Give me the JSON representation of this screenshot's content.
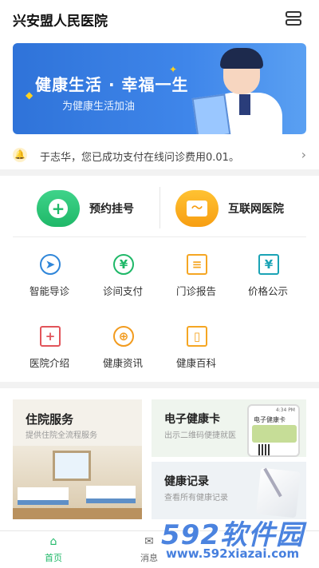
{
  "header": {
    "title": "兴安盟人民医院",
    "menu_icon": "menu-icon"
  },
  "banner": {
    "title": "健康生活 · 幸福一生",
    "subtitle": "为健康生活加油"
  },
  "notice": {
    "text": "于志华，您已成功支付在线问诊费用0.01。"
  },
  "primary_services": [
    {
      "label": "预约挂号",
      "icon": "hospital-cross-icon"
    },
    {
      "label": "互联网医院",
      "icon": "monitor-icon"
    }
  ],
  "grid": [
    {
      "label": "智能导诊",
      "icon": "navigation-icon"
    },
    {
      "label": "诊间支付",
      "icon": "yuan-icon"
    },
    {
      "label": "门诊报告",
      "icon": "report-icon"
    },
    {
      "label": "价格公示",
      "icon": "price-board-icon"
    },
    {
      "label": "医院介绍",
      "icon": "hospital-info-icon"
    },
    {
      "label": "健康资讯",
      "icon": "globe-icon"
    },
    {
      "label": "健康百科",
      "icon": "book-icon"
    }
  ],
  "cards": {
    "inpatient": {
      "title": "住院服务",
      "subtitle": "提供住院全流程服务"
    },
    "health_card": {
      "title": "电子健康卡",
      "subtitle": "出示二维码便捷就医",
      "phone_time": "4:34 PM",
      "phone_title": "电子健康卡"
    },
    "health_record": {
      "title": "健康记录",
      "subtitle": "查看所有健康记录"
    }
  },
  "tabbar": [
    {
      "label": "首页",
      "icon": "home-icon"
    },
    {
      "label": "消息",
      "icon": "message-icon"
    }
  ],
  "watermark": {
    "logo": "592软件园",
    "url": "www.592xiazai.com"
  },
  "colors": {
    "brand_green": "#1fb868",
    "banner_blue": "#3f86ea",
    "accent_orange": "#f79e12"
  }
}
